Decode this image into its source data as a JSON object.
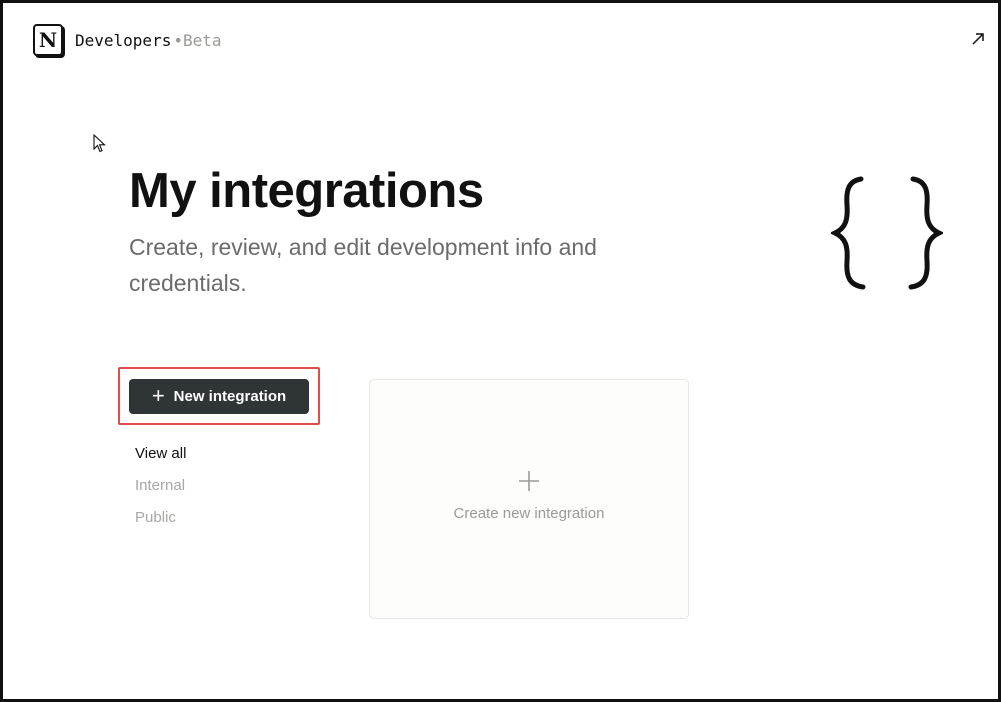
{
  "header": {
    "logo_letter": "N",
    "brand": "Developers",
    "separator": "•",
    "beta": "Beta",
    "external_icon": "arrow-up-right-icon"
  },
  "hero": {
    "title": "My integrations",
    "subtitle": "Create, review, and edit development info and credentials.",
    "illustration": "curly-braces-icon"
  },
  "sidebar": {
    "new_button": {
      "icon": "plus-icon",
      "label": "New integration"
    },
    "items": [
      {
        "label": "View all",
        "active": true
      },
      {
        "label": "Internal",
        "active": false
      },
      {
        "label": "Public",
        "active": false
      }
    ]
  },
  "main": {
    "create_card": {
      "icon": "plus-icon",
      "label": "Create new integration"
    }
  },
  "colors": {
    "button_bg": "#2f3437",
    "highlight": "#e24b4b",
    "muted_text": "#9b9a97",
    "card_border": "#e6e6e4"
  }
}
